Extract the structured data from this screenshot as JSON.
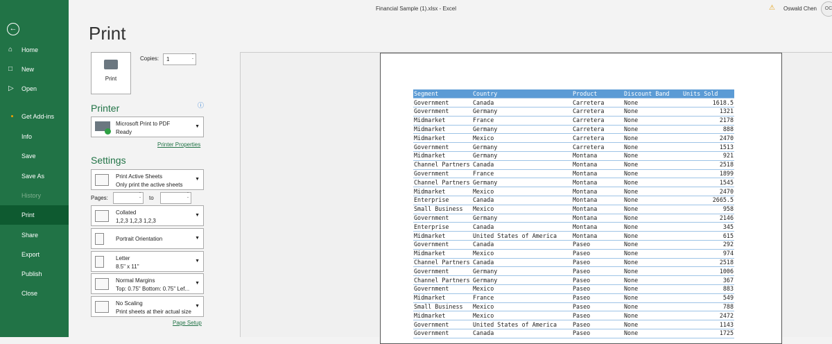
{
  "window": {
    "title": "Financial Sample (1).xlsx  -  Excel",
    "user": "Oswald Chen",
    "avatar": "OC"
  },
  "sidebar": {
    "items": [
      {
        "label": "Home",
        "icon": "home-icon"
      },
      {
        "label": "New",
        "icon": "new-doc-icon"
      },
      {
        "label": "Open",
        "icon": "folder-icon"
      },
      {
        "label": "Get Add-ins"
      },
      {
        "label": "Info"
      },
      {
        "label": "Save"
      },
      {
        "label": "Save As"
      },
      {
        "label": "History",
        "disabled": true
      },
      {
        "label": "Print",
        "active": true
      },
      {
        "label": "Share"
      },
      {
        "label": "Export"
      },
      {
        "label": "Publish"
      },
      {
        "label": "Close"
      }
    ]
  },
  "print": {
    "title": "Print",
    "button": "Print",
    "copies_label": "Copies:",
    "copies": "1",
    "printer_heading": "Printer",
    "printer_name": "Microsoft Print to PDF",
    "printer_status": "Ready",
    "printer_properties": "Printer Properties",
    "settings_heading": "Settings",
    "sheets": {
      "l1": "Print Active Sheets",
      "l2": "Only print the active sheets"
    },
    "pages_label": "Pages:",
    "to_label": "to",
    "collate": {
      "l1": "Collated",
      "l2": "1,2,3   1,2,3   1,2,3"
    },
    "orientation": {
      "l1": "Portrait Orientation"
    },
    "paper": {
      "l1": "Letter",
      "l2": "8.5\" x 11\""
    },
    "margins": {
      "l1": "Normal Margins",
      "l2": "Top: 0.75\" Bottom: 0.75\" Lef..."
    },
    "scaling": {
      "l1": "No Scaling",
      "l2": "Print sheets at their actual size"
    },
    "page_setup": "Page Setup"
  },
  "sheet": {
    "headers": [
      "Segment",
      "Country",
      "Product",
      "Discount Band",
      "Units Sold"
    ],
    "rows": [
      [
        "Government",
        "Canada",
        "Carretera",
        "None",
        "1618.5"
      ],
      [
        "Government",
        "Germany",
        "Carretera",
        "None",
        "1321"
      ],
      [
        "Midmarket",
        "France",
        "Carretera",
        "None",
        "2178"
      ],
      [
        "Midmarket",
        "Germany",
        "Carretera",
        "None",
        "888"
      ],
      [
        "Midmarket",
        "Mexico",
        "Carretera",
        "None",
        "2470"
      ],
      [
        "Government",
        "Germany",
        "Carretera",
        "None",
        "1513"
      ],
      [
        "Midmarket",
        "Germany",
        "Montana",
        "None",
        "921"
      ],
      [
        "Channel Partners",
        "Canada",
        "Montana",
        "None",
        "2518"
      ],
      [
        "Government",
        "France",
        "Montana",
        "None",
        "1899"
      ],
      [
        "Channel Partners",
        "Germany",
        "Montana",
        "None",
        "1545"
      ],
      [
        "Midmarket",
        "Mexico",
        "Montana",
        "None",
        "2470"
      ],
      [
        "Enterprise",
        "Canada",
        "Montana",
        "None",
        "2665.5"
      ],
      [
        "Small Business",
        "Mexico",
        "Montana",
        "None",
        "958"
      ],
      [
        "Government",
        "Germany",
        "Montana",
        "None",
        "2146"
      ],
      [
        "Enterprise",
        "Canada",
        "Montana",
        "None",
        "345"
      ],
      [
        "Midmarket",
        "United States of America",
        "Montana",
        "None",
        "615"
      ],
      [
        "Government",
        "Canada",
        "Paseo",
        "None",
        "292"
      ],
      [
        "Midmarket",
        "Mexico",
        "Paseo",
        "None",
        "974"
      ],
      [
        "Channel Partners",
        "Canada",
        "Paseo",
        "None",
        "2518"
      ],
      [
        "Government",
        "Germany",
        "Paseo",
        "None",
        "1006"
      ],
      [
        "Channel Partners",
        "Germany",
        "Paseo",
        "None",
        "367"
      ],
      [
        "Government",
        "Mexico",
        "Paseo",
        "None",
        "883"
      ],
      [
        "Midmarket",
        "France",
        "Paseo",
        "None",
        "549"
      ],
      [
        "Small Business",
        "Mexico",
        "Paseo",
        "None",
        "788"
      ],
      [
        "Midmarket",
        "Mexico",
        "Paseo",
        "None",
        "2472"
      ],
      [
        "Government",
        "United States of America",
        "Paseo",
        "None",
        "1143"
      ],
      [
        "Government",
        "Canada",
        "Paseo",
        "None",
        "1725"
      ]
    ]
  },
  "colors": {
    "accent": "#217346",
    "header": "#5b9bd5"
  }
}
